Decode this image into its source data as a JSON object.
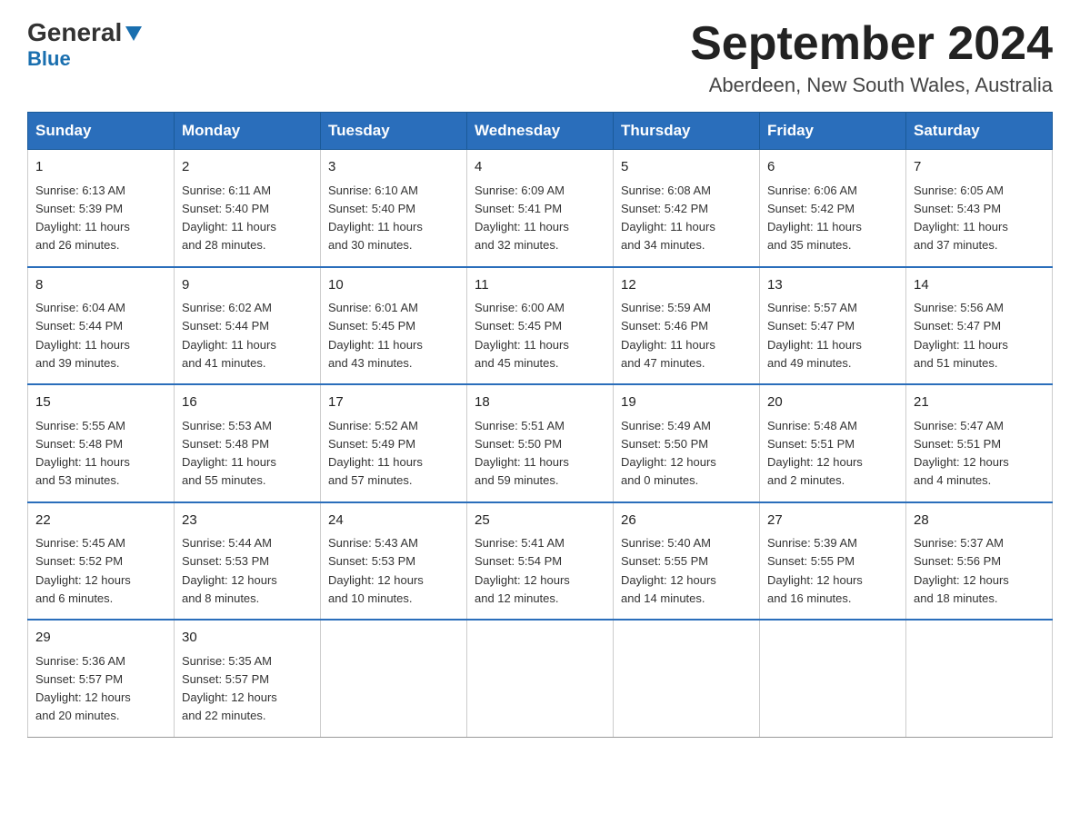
{
  "header": {
    "logo_general": "General",
    "logo_blue": "Blue",
    "main_title": "September 2024",
    "subtitle": "Aberdeen, New South Wales, Australia"
  },
  "calendar": {
    "days_of_week": [
      "Sunday",
      "Monday",
      "Tuesday",
      "Wednesday",
      "Thursday",
      "Friday",
      "Saturday"
    ],
    "weeks": [
      [
        {
          "date": "1",
          "sunrise": "6:13 AM",
          "sunset": "5:39 PM",
          "daylight": "11 hours and 26 minutes."
        },
        {
          "date": "2",
          "sunrise": "6:11 AM",
          "sunset": "5:40 PM",
          "daylight": "11 hours and 28 minutes."
        },
        {
          "date": "3",
          "sunrise": "6:10 AM",
          "sunset": "5:40 PM",
          "daylight": "11 hours and 30 minutes."
        },
        {
          "date": "4",
          "sunrise": "6:09 AM",
          "sunset": "5:41 PM",
          "daylight": "11 hours and 32 minutes."
        },
        {
          "date": "5",
          "sunrise": "6:08 AM",
          "sunset": "5:42 PM",
          "daylight": "11 hours and 34 minutes."
        },
        {
          "date": "6",
          "sunrise": "6:06 AM",
          "sunset": "5:42 PM",
          "daylight": "11 hours and 35 minutes."
        },
        {
          "date": "7",
          "sunrise": "6:05 AM",
          "sunset": "5:43 PM",
          "daylight": "11 hours and 37 minutes."
        }
      ],
      [
        {
          "date": "8",
          "sunrise": "6:04 AM",
          "sunset": "5:44 PM",
          "daylight": "11 hours and 39 minutes."
        },
        {
          "date": "9",
          "sunrise": "6:02 AM",
          "sunset": "5:44 PM",
          "daylight": "11 hours and 41 minutes."
        },
        {
          "date": "10",
          "sunrise": "6:01 AM",
          "sunset": "5:45 PM",
          "daylight": "11 hours and 43 minutes."
        },
        {
          "date": "11",
          "sunrise": "6:00 AM",
          "sunset": "5:45 PM",
          "daylight": "11 hours and 45 minutes."
        },
        {
          "date": "12",
          "sunrise": "5:59 AM",
          "sunset": "5:46 PM",
          "daylight": "11 hours and 47 minutes."
        },
        {
          "date": "13",
          "sunrise": "5:57 AM",
          "sunset": "5:47 PM",
          "daylight": "11 hours and 49 minutes."
        },
        {
          "date": "14",
          "sunrise": "5:56 AM",
          "sunset": "5:47 PM",
          "daylight": "11 hours and 51 minutes."
        }
      ],
      [
        {
          "date": "15",
          "sunrise": "5:55 AM",
          "sunset": "5:48 PM",
          "daylight": "11 hours and 53 minutes."
        },
        {
          "date": "16",
          "sunrise": "5:53 AM",
          "sunset": "5:48 PM",
          "daylight": "11 hours and 55 minutes."
        },
        {
          "date": "17",
          "sunrise": "5:52 AM",
          "sunset": "5:49 PM",
          "daylight": "11 hours and 57 minutes."
        },
        {
          "date": "18",
          "sunrise": "5:51 AM",
          "sunset": "5:50 PM",
          "daylight": "11 hours and 59 minutes."
        },
        {
          "date": "19",
          "sunrise": "5:49 AM",
          "sunset": "5:50 PM",
          "daylight": "12 hours and 0 minutes."
        },
        {
          "date": "20",
          "sunrise": "5:48 AM",
          "sunset": "5:51 PM",
          "daylight": "12 hours and 2 minutes."
        },
        {
          "date": "21",
          "sunrise": "5:47 AM",
          "sunset": "5:51 PM",
          "daylight": "12 hours and 4 minutes."
        }
      ],
      [
        {
          "date": "22",
          "sunrise": "5:45 AM",
          "sunset": "5:52 PM",
          "daylight": "12 hours and 6 minutes."
        },
        {
          "date": "23",
          "sunrise": "5:44 AM",
          "sunset": "5:53 PM",
          "daylight": "12 hours and 8 minutes."
        },
        {
          "date": "24",
          "sunrise": "5:43 AM",
          "sunset": "5:53 PM",
          "daylight": "12 hours and 10 minutes."
        },
        {
          "date": "25",
          "sunrise": "5:41 AM",
          "sunset": "5:54 PM",
          "daylight": "12 hours and 12 minutes."
        },
        {
          "date": "26",
          "sunrise": "5:40 AM",
          "sunset": "5:55 PM",
          "daylight": "12 hours and 14 minutes."
        },
        {
          "date": "27",
          "sunrise": "5:39 AM",
          "sunset": "5:55 PM",
          "daylight": "12 hours and 16 minutes."
        },
        {
          "date": "28",
          "sunrise": "5:37 AM",
          "sunset": "5:56 PM",
          "daylight": "12 hours and 18 minutes."
        }
      ],
      [
        {
          "date": "29",
          "sunrise": "5:36 AM",
          "sunset": "5:57 PM",
          "daylight": "12 hours and 20 minutes."
        },
        {
          "date": "30",
          "sunrise": "5:35 AM",
          "sunset": "5:57 PM",
          "daylight": "12 hours and 22 minutes."
        },
        null,
        null,
        null,
        null,
        null
      ]
    ],
    "labels": {
      "sunrise": "Sunrise: ",
      "sunset": "Sunset: ",
      "daylight": "Daylight: "
    }
  }
}
